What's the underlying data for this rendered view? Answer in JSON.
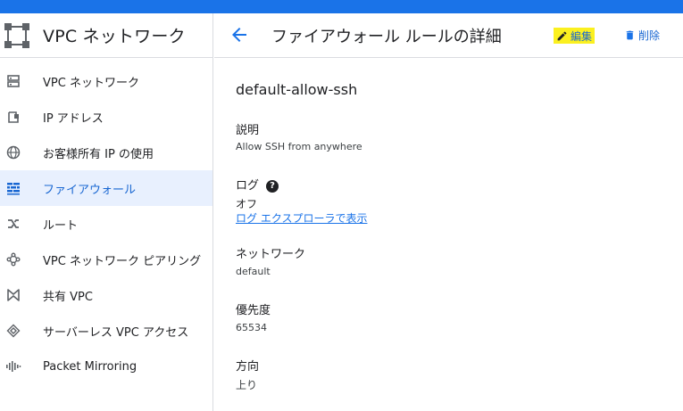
{
  "app": {
    "title": "VPC ネットワーク"
  },
  "sidebar": {
    "items": [
      {
        "label": "VPC ネットワーク",
        "icon": "vpc-network-icon"
      },
      {
        "label": "IP アドレス",
        "icon": "ip-address-icon"
      },
      {
        "label": "お客様所有 IP の使用",
        "icon": "globe-icon"
      },
      {
        "label": "ファイアウォール",
        "icon": "firewall-icon",
        "active": true
      },
      {
        "label": "ルート",
        "icon": "routes-icon"
      },
      {
        "label": "VPC ネットワーク ピアリング",
        "icon": "peering-icon"
      },
      {
        "label": "共有 VPC",
        "icon": "shared-vpc-icon"
      },
      {
        "label": "サーバーレス VPC アクセス",
        "icon": "serverless-icon"
      },
      {
        "label": "Packet Mirroring",
        "icon": "packet-mirroring-icon"
      }
    ]
  },
  "header": {
    "title": "ファイアウォール ルールの詳細",
    "edit_label": "編集",
    "delete_label": "削除"
  },
  "rule": {
    "name": "default-allow-ssh",
    "description_label": "説明",
    "description_value": "Allow SSH from anywhere",
    "logs_label": "ログ",
    "logs_help": "?",
    "logs_value": "オフ",
    "logs_link": "ログ エクスプローラで表示",
    "network_label": "ネットワーク",
    "network_value": "default",
    "priority_label": "優先度",
    "priority_value": "65534",
    "direction_label": "方向",
    "direction_value": "上り"
  },
  "colors": {
    "accent": "#1a73e8",
    "active_bg": "#e8f0fe",
    "highlight": "#fbf01f"
  }
}
